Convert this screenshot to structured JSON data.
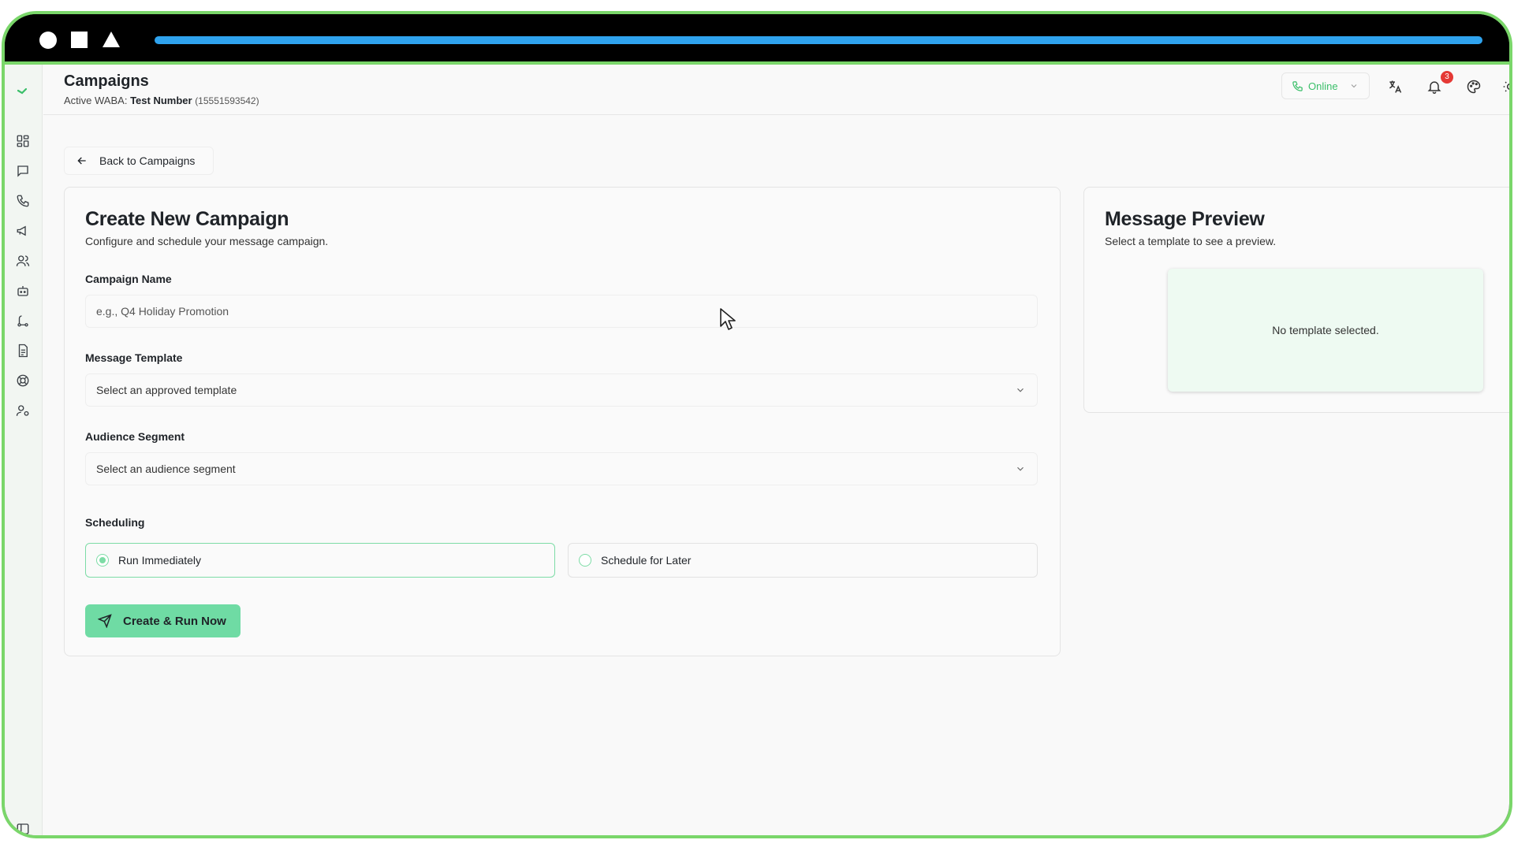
{
  "header": {
    "title": "Campaigns",
    "waba_prefix": "Active WABA:",
    "waba_name": "Test Number",
    "waba_number": "(15551593542)",
    "status_label": "Online",
    "notification_count": "3"
  },
  "back_label": "Back to Campaigns",
  "form": {
    "title": "Create New Campaign",
    "subtitle": "Configure and schedule your message campaign.",
    "campaign_name_label": "Campaign Name",
    "campaign_name_placeholder": "e.g., Q4 Holiday Promotion",
    "template_label": "Message Template",
    "template_value": "Select an approved template",
    "audience_label": "Audience Segment",
    "audience_value": "Select an audience segment",
    "scheduling_label": "Scheduling",
    "option_immediate": "Run Immediately",
    "option_later": "Schedule for Later",
    "selected_option": "immediate",
    "submit_label": "Create & Run Now"
  },
  "preview": {
    "title": "Message Preview",
    "subtitle": "Select a template to see a preview.",
    "empty_text": "No template selected."
  },
  "colors": {
    "accent": "#6fdba4",
    "online": "#3bbf6a",
    "frame": "#7ad66a",
    "badge": "#e53935"
  },
  "icons": {
    "sidebar": [
      "dashboard-icon",
      "chat-icon",
      "phone-icon",
      "megaphone-icon",
      "users-icon",
      "bot-icon",
      "flow-icon",
      "document-icon",
      "support-icon",
      "user-settings-icon"
    ],
    "header": [
      "phone-icon",
      "chevron-down-icon",
      "translate-icon",
      "bell-icon",
      "palette-icon",
      "sun-icon"
    ]
  }
}
